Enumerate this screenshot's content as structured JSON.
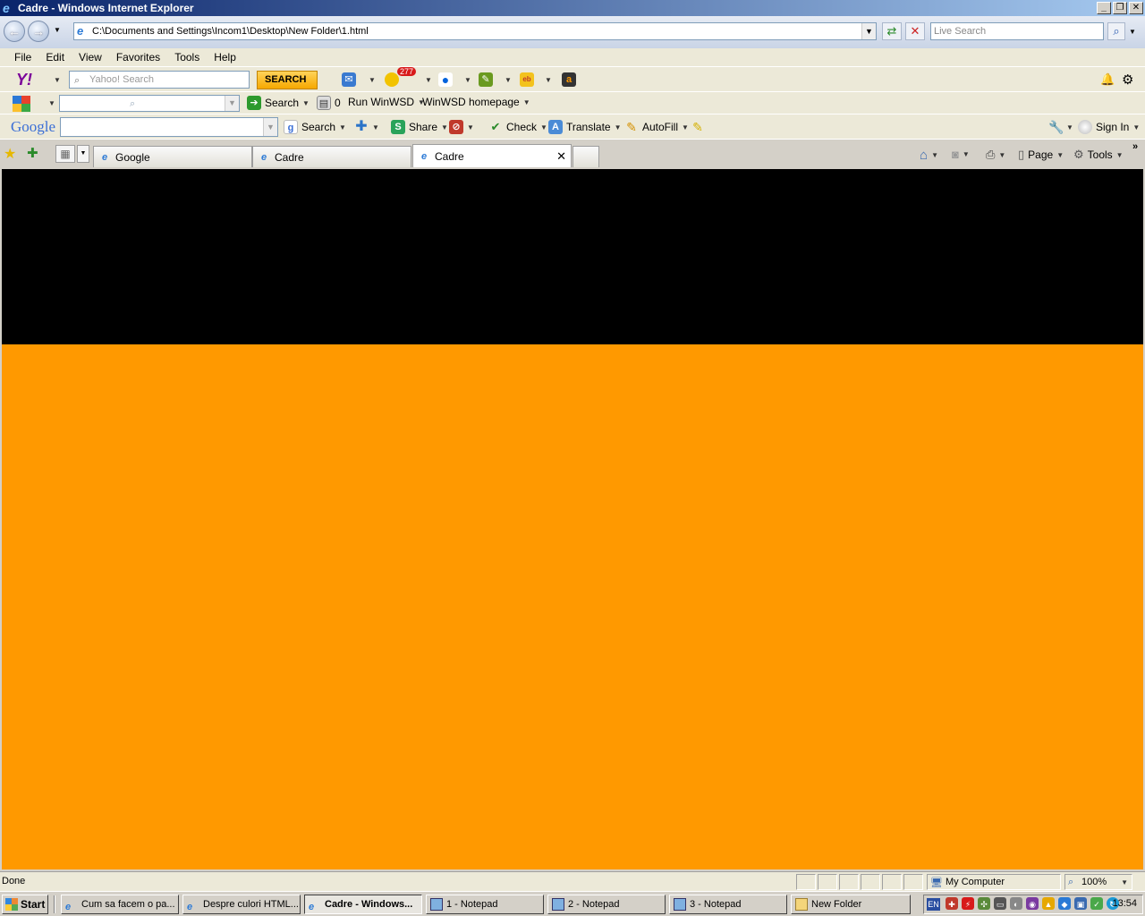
{
  "window": {
    "title": "Cadre - Windows Internet Explorer"
  },
  "address": {
    "url": "C:\\Documents and Settings\\Incom1\\Desktop\\New Folder\\1.html"
  },
  "livesearch": {
    "placeholder": "Live Search"
  },
  "menu": [
    "File",
    "Edit",
    "View",
    "Favorites",
    "Tools",
    "Help"
  ],
  "yahoo": {
    "search_placeholder": "Yahoo! Search",
    "search_button": "SEARCH",
    "badge": "277"
  },
  "wsd": {
    "search_label": "Search",
    "count": "0",
    "run_label": "Run WinWSD",
    "home_label": "WinWSD homepage"
  },
  "google": {
    "logo": "Google",
    "search_label": "Search",
    "share_label": "Share",
    "check_label": "Check",
    "translate_label": "Translate",
    "autofill_label": "AutoFill",
    "signin_label": "Sign In"
  },
  "tabs": [
    {
      "label": "Google"
    },
    {
      "label": "Cadre"
    },
    {
      "label": "Cadre"
    }
  ],
  "commandbar": {
    "page_label": "Page",
    "tools_label": "Tools"
  },
  "status": {
    "text": "Done",
    "zone": "My Computer",
    "zoom": "100%"
  },
  "taskbar": {
    "start": "Start",
    "tasks": [
      "Cum sa facem o pa...",
      "Despre culori HTML...",
      "Cadre - Windows...",
      "1 - Notepad",
      "2 - Notepad",
      "3 - Notepad",
      "New Folder"
    ],
    "lang": "EN",
    "clock": "13:54"
  },
  "colors": {
    "band_top": "#000000",
    "band_bottom": "#ff9900"
  }
}
